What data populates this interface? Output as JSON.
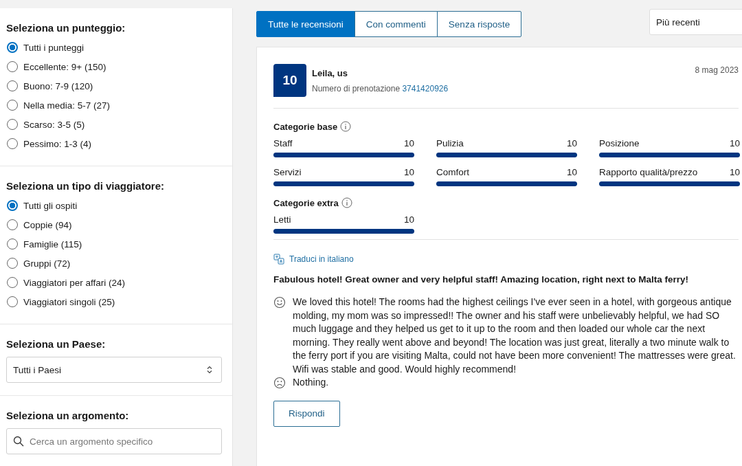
{
  "filters": {
    "score": {
      "title": "Seleziona un punteggio:",
      "options": [
        {
          "label": "Tutti i punteggi",
          "selected": true
        },
        {
          "label": "Eccellente: 9+ (150)",
          "selected": false
        },
        {
          "label": "Buono: 7-9 (120)",
          "selected": false
        },
        {
          "label": "Nella media: 5-7 (27)",
          "selected": false
        },
        {
          "label": "Scarso: 3-5 (5)",
          "selected": false
        },
        {
          "label": "Pessimo: 1-3 (4)",
          "selected": false
        }
      ]
    },
    "traveler": {
      "title": "Seleziona un tipo di viaggiatore:",
      "options": [
        {
          "label": "Tutti gli ospiti",
          "selected": true
        },
        {
          "label": "Coppie (94)",
          "selected": false
        },
        {
          "label": "Famiglie (115)",
          "selected": false
        },
        {
          "label": "Gruppi (72)",
          "selected": false
        },
        {
          "label": "Viaggiatori per affari (24)",
          "selected": false
        },
        {
          "label": "Viaggiatori singoli (25)",
          "selected": false
        }
      ]
    },
    "country": {
      "title": "Seleziona un Paese:",
      "value": "Tutti i Paesi"
    },
    "topic": {
      "title": "Seleziona un argomento:",
      "placeholder": "Cerca un argomento specifico"
    }
  },
  "tabs": [
    {
      "label": "Tutte le recensioni",
      "selected": true
    },
    {
      "label": "Con commenti",
      "selected": false
    },
    {
      "label": "Senza risposte",
      "selected": false
    }
  ],
  "sort": {
    "value": "Più recenti"
  },
  "review": {
    "score": "10",
    "name": "Leila, us",
    "booking_label": "Numero di prenotazione",
    "booking_number": "3741420926",
    "date": "8 mag 2023",
    "category_groups": [
      {
        "title": "Categorie base",
        "items": [
          {
            "label": "Staff",
            "value": "10",
            "level": 1
          },
          {
            "label": "Pulizia",
            "value": "10",
            "level": 1
          },
          {
            "label": "Posizione",
            "value": "10",
            "level": 1
          },
          {
            "label": "Servizi",
            "value": "10",
            "level": 1
          },
          {
            "label": "Comfort",
            "value": "10",
            "level": 1
          },
          {
            "label": "Rapporto qualità/prezzo",
            "value": "10",
            "level": 1
          }
        ]
      },
      {
        "title": "Categorie extra",
        "items": [
          {
            "label": "Letti",
            "value": "10",
            "level": 1
          }
        ]
      }
    ],
    "translate": "Traduci in italiano",
    "title": "Fabulous hotel! Great owner and very helpful staff! Amazing location, right next to Malta ferry!",
    "comments": [
      {
        "kind": "positive",
        "text": "We loved this hotel! The rooms had the highest ceilings I've ever seen in a hotel, with gorgeous antique molding, my mom was so impressed!! The owner and his staff were unbelievably helpful, we had SO much luggage and they helped us get to it up to the room and then loaded our whole car the next morning. They really went above and beyond! The location was just great, literally a two minute walk to the ferry port if you are visiting Malta, could not have been more convenient! The mattresses were great. Wifi was stable and good. Would highly recommend!"
      },
      {
        "kind": "negative",
        "text": "Nothing."
      }
    ],
    "reply": "Rispondi"
  }
}
